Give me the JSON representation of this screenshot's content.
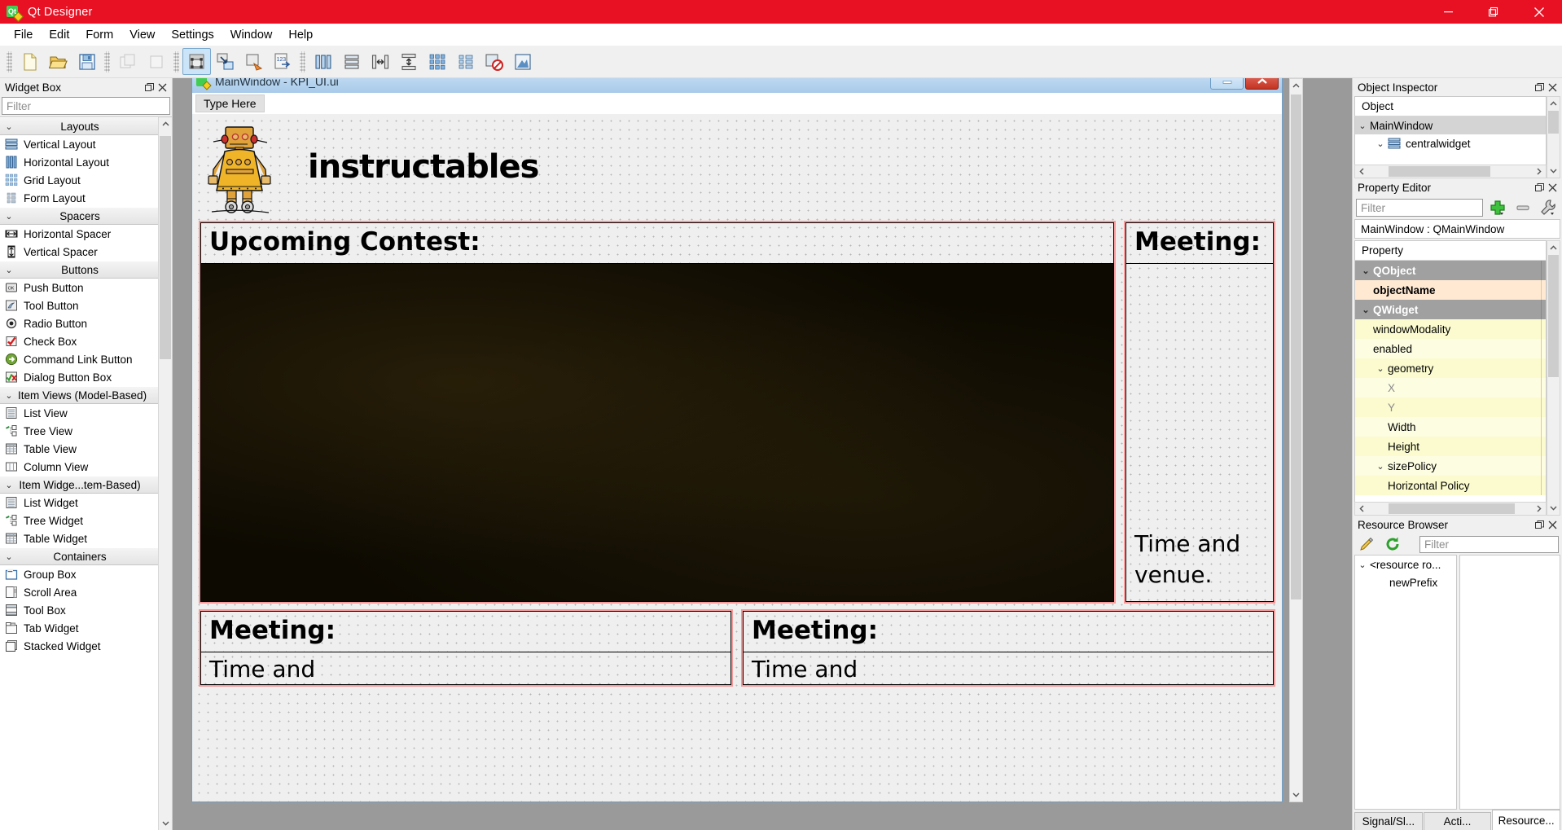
{
  "window": {
    "title": "Qt Designer",
    "icon": "qt-designer-icon",
    "minimize_label": "minimize-icon",
    "maximize_label": "restore-icon",
    "close_label": "close-icon"
  },
  "menubar": {
    "items": [
      {
        "label": "File"
      },
      {
        "label": "Edit"
      },
      {
        "label": "Form"
      },
      {
        "label": "View"
      },
      {
        "label": "Settings"
      },
      {
        "label": "Window"
      },
      {
        "label": "Help"
      }
    ]
  },
  "toolbar": {
    "groups": [
      {
        "buttons": [
          {
            "name": "new-form-button",
            "icon": "new-file-icon",
            "state": "normal"
          },
          {
            "name": "open-form-button",
            "icon": "open-folder-icon",
            "state": "normal"
          },
          {
            "name": "save-form-button",
            "icon": "save-disk-icon",
            "state": "normal"
          }
        ]
      },
      {
        "buttons": [
          {
            "name": "undo-button",
            "icon": "undo-icon",
            "state": "disabled"
          },
          {
            "name": "redo-button",
            "icon": "redo-icon",
            "state": "disabled"
          }
        ]
      },
      {
        "buttons": [
          {
            "name": "edit-widgets-button",
            "icon": "edit-widgets-icon",
            "state": "active"
          },
          {
            "name": "edit-signals-slots-button",
            "icon": "signals-slots-icon",
            "state": "normal"
          },
          {
            "name": "edit-buddies-button",
            "icon": "buddies-icon",
            "state": "normal"
          },
          {
            "name": "edit-tab-order-button",
            "icon": "tab-order-icon",
            "state": "normal"
          }
        ]
      },
      {
        "buttons": [
          {
            "name": "layout-horizontally-button",
            "icon": "layout-horizontal-icon",
            "state": "normal"
          },
          {
            "name": "layout-vertically-button",
            "icon": "layout-vertical-icon",
            "state": "normal"
          },
          {
            "name": "layout-horizontal-splitter-button",
            "icon": "splitter-horizontal-icon",
            "state": "normal"
          },
          {
            "name": "layout-vertical-splitter-button",
            "icon": "splitter-vertical-icon",
            "state": "normal"
          },
          {
            "name": "layout-grid-button",
            "icon": "layout-grid-icon",
            "state": "normal"
          },
          {
            "name": "layout-form-button",
            "icon": "layout-form-icon",
            "state": "normal"
          },
          {
            "name": "break-layout-button",
            "icon": "break-layout-icon",
            "state": "normal"
          },
          {
            "name": "adjust-size-button",
            "icon": "adjust-size-icon",
            "state": "normal"
          }
        ]
      }
    ]
  },
  "widget_box": {
    "title": "Widget Box",
    "float_icon": "float-icon",
    "close_icon": "close-icon",
    "filter_placeholder": "Filter",
    "filter_value": "",
    "sections": [
      {
        "label": "Layouts",
        "expanded": true,
        "items": [
          {
            "label": "Vertical Layout",
            "icon": "vertical-layout-icon"
          },
          {
            "label": "Horizontal Layout",
            "icon": "horizontal-layout-icon"
          },
          {
            "label": "Grid Layout",
            "icon": "grid-layout-icon"
          },
          {
            "label": "Form Layout",
            "icon": "form-layout-icon"
          }
        ]
      },
      {
        "label": "Spacers",
        "expanded": true,
        "items": [
          {
            "label": "Horizontal Spacer",
            "icon": "horizontal-spacer-icon"
          },
          {
            "label": "Vertical Spacer",
            "icon": "vertical-spacer-icon"
          }
        ]
      },
      {
        "label": "Buttons",
        "expanded": true,
        "items": [
          {
            "label": "Push Button",
            "icon": "push-button-icon"
          },
          {
            "label": "Tool Button",
            "icon": "tool-button-icon"
          },
          {
            "label": "Radio Button",
            "icon": "radio-button-icon"
          },
          {
            "label": "Check Box",
            "icon": "check-box-icon"
          },
          {
            "label": "Command Link Button",
            "icon": "command-link-icon"
          },
          {
            "label": "Dialog Button Box",
            "icon": "dialog-button-box-icon"
          }
        ]
      },
      {
        "label": "Item Views (Model-Based)",
        "expanded": true,
        "items": [
          {
            "label": "List View",
            "icon": "list-view-icon"
          },
          {
            "label": "Tree View",
            "icon": "tree-view-icon"
          },
          {
            "label": "Table View",
            "icon": "table-view-icon"
          },
          {
            "label": "Column View",
            "icon": "column-view-icon"
          }
        ]
      },
      {
        "label": "Item Widge...tem-Based)",
        "expanded": true,
        "items": [
          {
            "label": "List Widget",
            "icon": "list-widget-icon"
          },
          {
            "label": "Tree Widget",
            "icon": "tree-widget-icon"
          },
          {
            "label": "Table Widget",
            "icon": "table-widget-icon"
          }
        ]
      },
      {
        "label": "Containers",
        "expanded": true,
        "items": [
          {
            "label": "Group Box",
            "icon": "group-box-icon"
          },
          {
            "label": "Scroll Area",
            "icon": "scroll-area-icon"
          },
          {
            "label": "Tool Box",
            "icon": "tool-box-icon"
          },
          {
            "label": "Tab Widget",
            "icon": "tab-widget-icon"
          },
          {
            "label": "Stacked Widget",
            "icon": "stacked-widget-icon"
          }
        ]
      }
    ]
  },
  "form_window": {
    "title": "MainWindow - KPI_UI.ui",
    "icon": "qt-designer-icon",
    "minimize_label": "minimize-icon",
    "close_label": "close-icon",
    "menu_placeholder": "Type Here",
    "brand": "instructables",
    "logo_icon": "instructables-robot-icon",
    "cells": {
      "contest_header": "Upcoming Contest:",
      "contest_image": "contest-image",
      "meeting_right_header": "Meeting:",
      "meeting_right_body": "Time and venue.",
      "meeting_bottom_left_header": "Meeting:",
      "meeting_bottom_left_body": "Time and",
      "meeting_bottom_right_header": "Meeting:",
      "meeting_bottom_right_body": "Time and"
    }
  },
  "object_inspector": {
    "title": "Object Inspector",
    "float_icon": "float-icon",
    "close_icon": "close-icon",
    "column_header": "Object",
    "rows": [
      {
        "label": "MainWindow",
        "indent": 0,
        "selected": true,
        "icon": ""
      },
      {
        "label": "centralwidget",
        "indent": 1,
        "selected": false,
        "icon": "vertical-layout-icon"
      }
    ]
  },
  "property_editor": {
    "title": "Property Editor",
    "float_icon": "float-icon",
    "close_icon": "close-icon",
    "filter_placeholder": "Filter",
    "filter_value": "",
    "add_button": "add-property-icon",
    "remove_button": "remove-property-icon",
    "configure_button": "configure-icon",
    "object_line": "MainWindow : QMainWindow",
    "column_header": "Property",
    "rows": [
      {
        "label": "QObject",
        "kind": "group",
        "indent": 0
      },
      {
        "label": "objectName",
        "kind": "highlight",
        "indent": 1
      },
      {
        "label": "QWidget",
        "kind": "group",
        "indent": 0
      },
      {
        "label": "windowModality",
        "kind": "yellow",
        "indent": 1
      },
      {
        "label": "enabled",
        "kind": "yellow2",
        "indent": 1
      },
      {
        "label": "geometry",
        "kind": "yellow",
        "indent": 1,
        "expandable": true
      },
      {
        "label": "X",
        "kind": "yellow2",
        "indent": 2,
        "dim": true
      },
      {
        "label": "Y",
        "kind": "yellow",
        "indent": 2,
        "dim": true
      },
      {
        "label": "Width",
        "kind": "yellow2",
        "indent": 2
      },
      {
        "label": "Height",
        "kind": "yellow",
        "indent": 2
      },
      {
        "label": "sizePolicy",
        "kind": "yellow2",
        "indent": 1,
        "expandable": true
      },
      {
        "label": "Horizontal Policy",
        "kind": "yellow",
        "indent": 2
      }
    ]
  },
  "resource_browser": {
    "title": "Resource Browser",
    "float_icon": "float-icon",
    "close_icon": "close-icon",
    "edit_button": "pencil-icon",
    "reload_button": "reload-icon",
    "filter_placeholder": "Filter",
    "filter_value": "",
    "tree": [
      {
        "label": "<resource ro...",
        "indent": 0,
        "expanded": true
      },
      {
        "label": "newPrefix",
        "indent": 1
      }
    ],
    "tabs": [
      {
        "label": "Signal/Sl...",
        "selected": false
      },
      {
        "label": "Acti...",
        "selected": false
      },
      {
        "label": "Resource...",
        "selected": true
      }
    ]
  },
  "colors": {
    "titlebar": "#e81123",
    "selection": "#cce4f7",
    "form_border_red": "#f49a9a",
    "property_yellow": "#fbfbcf",
    "property_highlight": "#ffe9d3"
  }
}
